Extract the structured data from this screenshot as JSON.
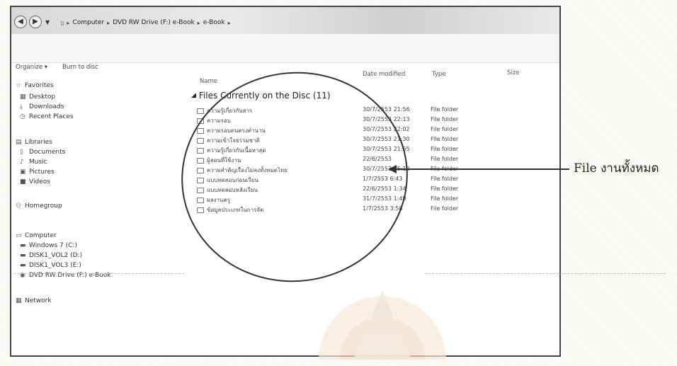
{
  "address_bar": {
    "segments": [
      "Computer",
      "DVD RW Drive (F:) e-Book",
      "e-Book"
    ]
  },
  "toolbar": {
    "organize_label": "Organize ▾",
    "burn_label": "Burn to disc"
  },
  "sidebar": {
    "favorites": {
      "header": "Favorites",
      "items": [
        "Desktop",
        "Downloads",
        "Recent Places"
      ]
    },
    "libraries": {
      "header": "Libraries",
      "items": [
        "Documents",
        "Music",
        "Pictures",
        "Videos"
      ]
    },
    "homegroup": "Homegroup",
    "computer": {
      "header": "Computer",
      "items": [
        "Windows 7 (C:)",
        "DISK1_VOL2 (D:)",
        "DISK1_VOL3 (E:)",
        "DVD RW Drive (F:) e-Book"
      ]
    },
    "network": "Network"
  },
  "columns": {
    "name": "Name",
    "date_modified": "Date modified",
    "type": "Type",
    "size": "Size"
  },
  "file_group": {
    "label": "Files Currently on the Disc (11)"
  },
  "files": [
    {
      "name": "ความรู้เกี่ยวกับสาร",
      "date": "30/7/2553 21:56",
      "type": "File folder"
    },
    {
      "name": "ความรอบ",
      "date": "30/7/2553 22:13",
      "type": "File folder"
    },
    {
      "name": "ความรอบตนตรงตำนาน",
      "date": "30/7/2553 22:02",
      "type": "File folder"
    },
    {
      "name": "ความเข้าใจธรรมชาติ",
      "date": "30/7/2553 21:30",
      "type": "File folder"
    },
    {
      "name": "ความรู้เกี่ยวกับเนื้อหาสุด",
      "date": "30/7/2553 21:55",
      "type": "File folder"
    },
    {
      "name": "ผู้สอนที่ใช้งาน",
      "date": "22/6/2553",
      "type": "File folder"
    },
    {
      "name": "ความสำคัญเรื่องไม่ลงทั้งหมดไทย",
      "date": "30/7/2553 15:12",
      "type": "File folder"
    },
    {
      "name": "แบบทดสอบก่อนเรียน",
      "date": "1/7/2553 6:43",
      "type": "File folder"
    },
    {
      "name": "แบบทดสอบหลังเรียน",
      "date": "22/6/2553 1:34",
      "type": "File folder"
    },
    {
      "name": "ผลงานครู",
      "date": "31/7/2553 1:48",
      "type": "File folder"
    },
    {
      "name": "ข้อมูลประเภทในการจัด",
      "date": "1/7/2553 3:58",
      "type": "File folder"
    }
  ],
  "annotation": {
    "label": "File งานทั้งหมด"
  },
  "colors": {
    "ink": "#333333",
    "window_border": "#444444"
  }
}
